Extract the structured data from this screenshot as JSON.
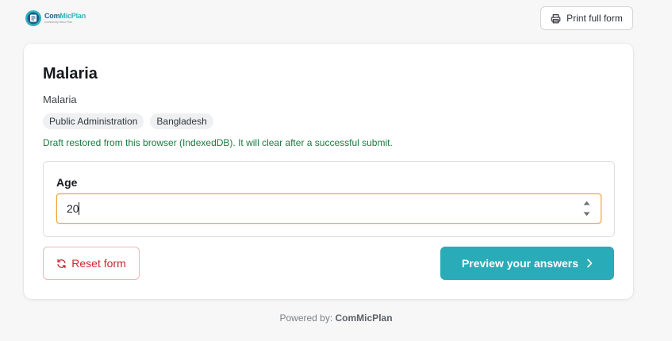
{
  "brand": {
    "name_part1": "Com",
    "name_part2": "MicPlan",
    "tagline": "Community Micro Plan",
    "colors": {
      "primary": "#1c5d8a",
      "accent": "#2fb3bf"
    }
  },
  "header": {
    "print_label": "Print full form",
    "print_icon": "printer-icon"
  },
  "form": {
    "title": "Malaria",
    "subtitle": "Malaria",
    "tags": [
      "Public Administration",
      "Bangladesh"
    ],
    "draft_note": "Draft restored from this browser (IndexedDB). It will clear after a successful submit."
  },
  "fields": {
    "age": {
      "label": "Age",
      "value": "20",
      "focus_color": "#f0a436"
    }
  },
  "actions": {
    "reset_label": "Reset form",
    "reset_icon": "refresh-icon",
    "reset_color": "#c8282d",
    "preview_label": "Preview your answers",
    "preview_icon": "chevron-right-icon",
    "preview_color": "#2aabb8"
  },
  "footer": {
    "powered_by_label": "Powered by:",
    "powered_by_brand": "ComMicPlan"
  }
}
